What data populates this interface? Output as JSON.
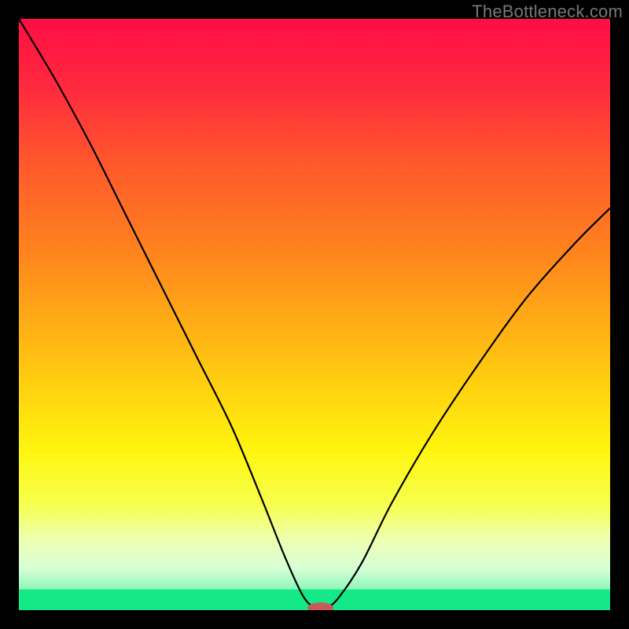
{
  "watermark": "TheBottleneck.com",
  "chart_data": {
    "type": "line",
    "title": "",
    "xlabel": "",
    "ylabel": "",
    "xlim": [
      0,
      100
    ],
    "ylim": [
      0,
      100
    ],
    "legend": false,
    "grid": false,
    "background_gradient_stops": [
      {
        "offset": 0.0,
        "color": "#ff0d45"
      },
      {
        "offset": 0.12,
        "color": "#ff2b3d"
      },
      {
        "offset": 0.25,
        "color": "#ff5a2b"
      },
      {
        "offset": 0.38,
        "color": "#ff7f1f"
      },
      {
        "offset": 0.5,
        "color": "#ffa816"
      },
      {
        "offset": 0.62,
        "color": "#ffd010"
      },
      {
        "offset": 0.73,
        "color": "#fff50e"
      },
      {
        "offset": 0.82,
        "color": "#f7ff4d"
      },
      {
        "offset": 0.88,
        "color": "#eeffb0"
      },
      {
        "offset": 0.93,
        "color": "#d6ffd6"
      },
      {
        "offset": 0.965,
        "color": "#8ef7b8"
      },
      {
        "offset": 1.0,
        "color": "#15e887"
      }
    ],
    "series": [
      {
        "name": "bottleneck-curve",
        "stroke": "#000000",
        "stroke_width": 2.2,
        "x": [
          0,
          6,
          12,
          18,
          24,
          30,
          36,
          41,
          45,
          48,
          50,
          52,
          54,
          58,
          63,
          70,
          78,
          86,
          94,
          100
        ],
        "values": [
          100,
          90,
          79,
          67,
          55,
          43,
          31,
          19,
          9,
          2.5,
          0.5,
          0.5,
          2,
          8,
          18,
          30,
          42,
          53,
          62,
          68
        ]
      }
    ],
    "marker": {
      "name": "min-marker",
      "x": 51,
      "y": 0.4,
      "rx": 2.2,
      "ry": 0.9,
      "fill": "#c75a5a"
    },
    "green_band": {
      "y0": 0,
      "y1": 3.5
    }
  }
}
